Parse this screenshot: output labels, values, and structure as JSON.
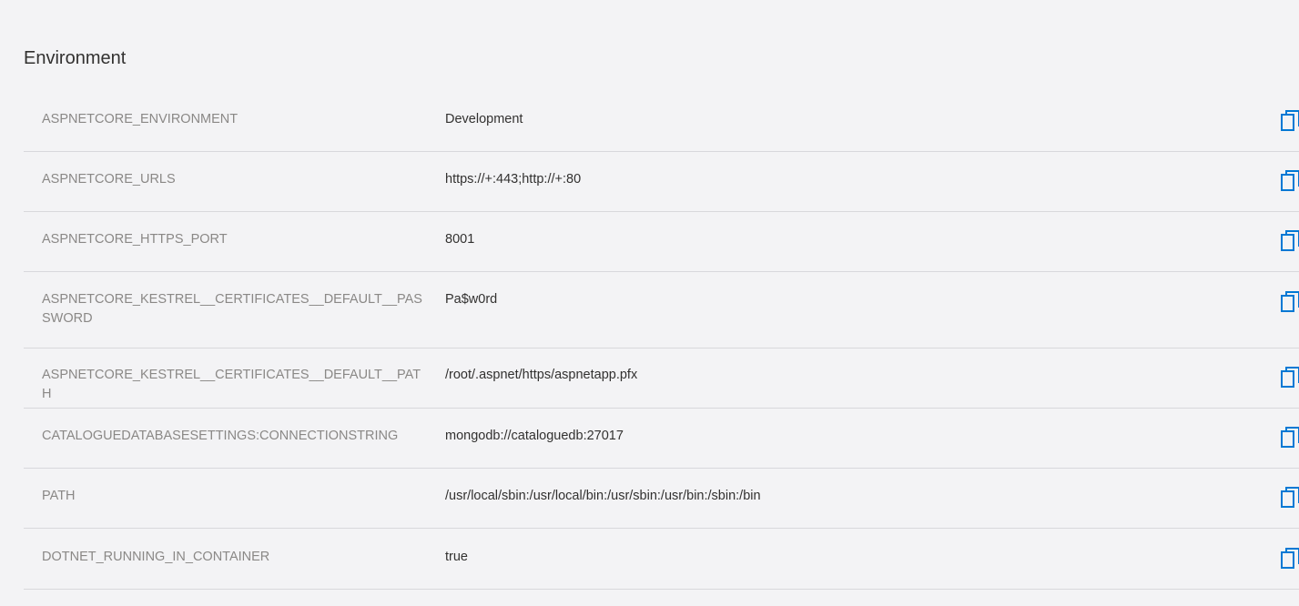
{
  "section": {
    "title": "Environment"
  },
  "env_vars": [
    {
      "key": "ASPNETCORE_ENVIRONMENT",
      "value": "Development"
    },
    {
      "key": "ASPNETCORE_URLS",
      "value": "https://+:443;http://+:80"
    },
    {
      "key": "ASPNETCORE_HTTPS_PORT",
      "value": "8001"
    },
    {
      "key": "ASPNETCORE_KESTREL__CERTIFICATES__DEFAULT__PASSWORD",
      "value": "Pa$w0rd"
    },
    {
      "key": "ASPNETCORE_KESTREL__CERTIFICATES__DEFAULT__PATH",
      "value": "/root/.aspnet/https/aspnetapp.pfx"
    },
    {
      "key": "CATALOGUEDATABASESETTINGS:CONNECTIONSTRING",
      "value": "mongodb://cataloguedb:27017"
    },
    {
      "key": "PATH",
      "value": "/usr/local/sbin:/usr/local/bin:/usr/sbin:/usr/bin:/sbin:/bin"
    },
    {
      "key": "DOTNET_RUNNING_IN_CONTAINER",
      "value": "true"
    }
  ],
  "icons": {
    "copy": "copy-icon"
  },
  "colors": {
    "accent": "#0078d4",
    "key_text": "#8a8886",
    "value_text": "#323130",
    "divider": "#d8d8dc",
    "background": "#f3f3f5"
  }
}
